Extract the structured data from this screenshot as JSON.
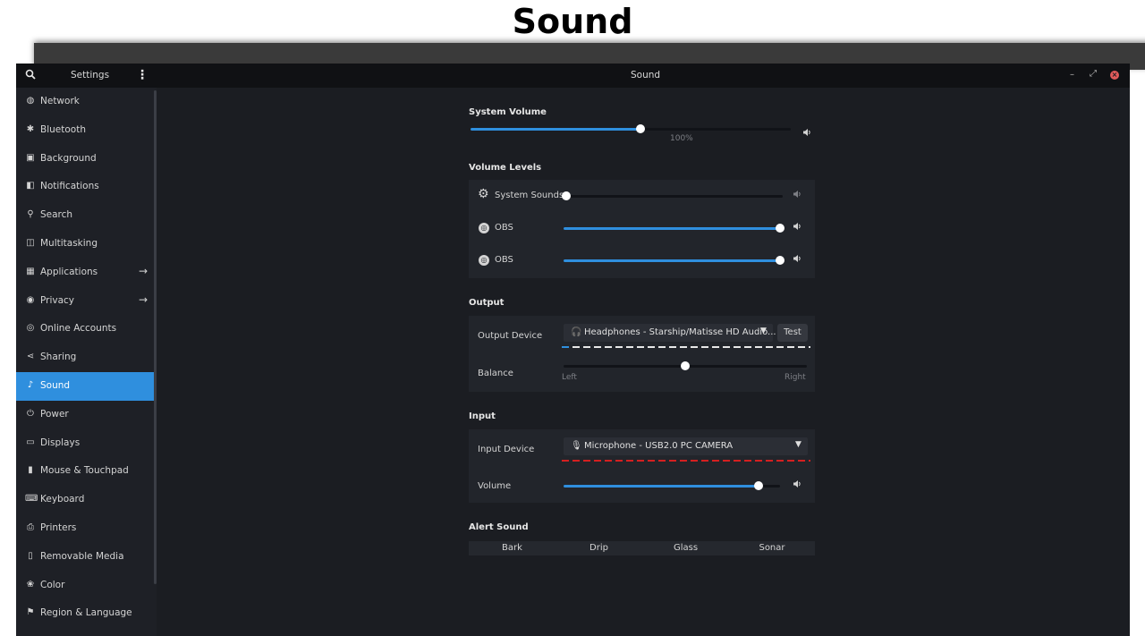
{
  "page": {
    "title": "Sound"
  },
  "headerbar": {
    "left_title": "Settings",
    "title": "Sound",
    "search_icon": "search-icon",
    "menu_icon": "kebab-menu-icon",
    "min_glyph": "–",
    "max_glyph": "⤢",
    "close_glyph": "×"
  },
  "sidebar": {
    "items": [
      {
        "label": "Network",
        "icon": "network-icon",
        "glyph": "◍"
      },
      {
        "label": "Bluetooth",
        "icon": "bluetooth-icon",
        "glyph": "✱"
      },
      {
        "label": "Background",
        "icon": "background-icon",
        "glyph": "▣"
      },
      {
        "label": "Notifications",
        "icon": "notifications-icon",
        "glyph": "◧"
      },
      {
        "label": "Search",
        "icon": "search-icon",
        "glyph": "⚲"
      },
      {
        "label": "Multitasking",
        "icon": "multitasking-icon",
        "glyph": "◫"
      },
      {
        "label": "Applications",
        "icon": "applications-icon",
        "glyph": "▦"
      },
      {
        "label": "Privacy",
        "icon": "privacy-icon",
        "glyph": "◉"
      },
      {
        "label": "Online Accounts",
        "icon": "online-accounts-icon",
        "glyph": "◎"
      },
      {
        "label": "Sharing",
        "icon": "sharing-icon",
        "glyph": "⋖"
      },
      {
        "label": "Sound",
        "icon": "sound-icon",
        "glyph": "♪"
      },
      {
        "label": "Power",
        "icon": "power-icon",
        "glyph": "⏻"
      },
      {
        "label": "Displays",
        "icon": "displays-icon",
        "glyph": "▭"
      },
      {
        "label": "Mouse & Touchpad",
        "icon": "mouse-icon",
        "glyph": "▮"
      },
      {
        "label": "Keyboard",
        "icon": "keyboard-icon",
        "glyph": "⌨"
      },
      {
        "label": "Printers",
        "icon": "printer-icon",
        "glyph": "⎙"
      },
      {
        "label": "Removable Media",
        "icon": "removable-media-icon",
        "glyph": "▯"
      },
      {
        "label": "Color",
        "icon": "color-icon",
        "glyph": "❀"
      },
      {
        "label": "Region & Language",
        "icon": "region-icon",
        "glyph": "⚑"
      }
    ],
    "active": "Sound",
    "arrow_glyph": "→"
  },
  "system_volume": {
    "title": "System Volume",
    "level": 0.53,
    "tick_label": "100%",
    "speaker_glyph": "🔊"
  },
  "volume_levels": {
    "title": "Volume Levels",
    "rows": [
      {
        "label": "System Sounds",
        "icon": "gear-icon",
        "level": 0.0
      },
      {
        "label": "OBS",
        "icon": "obs-icon",
        "level": 1.0
      },
      {
        "label": "OBS",
        "icon": "obs-icon",
        "level": 1.0
      }
    ]
  },
  "output": {
    "title": "Output",
    "device_label": "Output Device",
    "device_value": "Headphones - Starship/Matisse HD Audio...",
    "device_icon": "headphones-icon",
    "test_label": "Test",
    "balance_label": "Balance",
    "balance_value": 0.5,
    "left_label": "Left",
    "right_label": "Right",
    "level_color": "#2f8fde"
  },
  "input": {
    "title": "Input",
    "device_label": "Input Device",
    "device_value": "Microphone - USB2.0 PC CAMERA",
    "device_icon": "microphone-icon",
    "volume_label": "Volume",
    "volume_level": 0.9,
    "level_color": "#d42020"
  },
  "alert_sound": {
    "title": "Alert Sound",
    "options": [
      "Bark",
      "Drip",
      "Glass",
      "Sonar"
    ]
  }
}
